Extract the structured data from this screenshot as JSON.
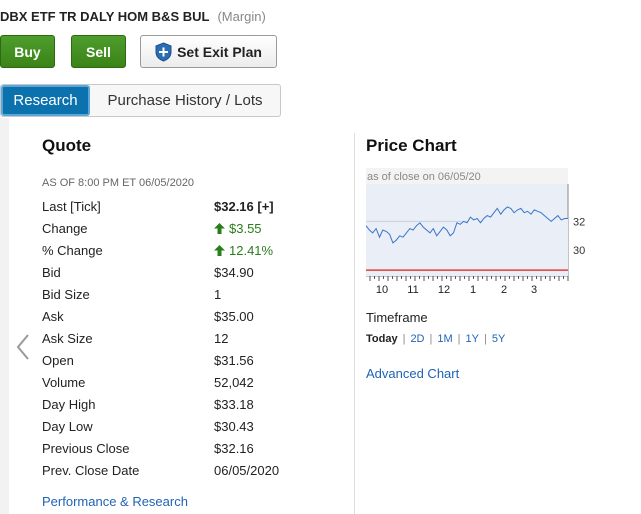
{
  "header": {
    "title": "DBX ETF TR DALY HOM B&S BUL",
    "margin": "(Margin)"
  },
  "actions": {
    "buy": "Buy",
    "sell": "Sell",
    "exit_plan": "Set Exit Plan"
  },
  "tabs": {
    "active": "Research",
    "other": "Purchase History / Lots"
  },
  "quote": {
    "title": "Quote",
    "as_of": "AS OF 8:00 PM ET 06/05/2020",
    "rows": [
      {
        "label": "Last [Tick]",
        "value": "$32.16 [+]"
      },
      {
        "label": "Change",
        "value": "$3.55"
      },
      {
        "label": "% Change",
        "value": "12.41%"
      },
      {
        "label": "Bid",
        "value": "$34.90"
      },
      {
        "label": "Bid Size",
        "value": "1"
      },
      {
        "label": "Ask",
        "value": "$35.00"
      },
      {
        "label": "Ask Size",
        "value": "12"
      },
      {
        "label": "Open",
        "value": "$31.56"
      },
      {
        "label": "Volume",
        "value": "52,042"
      },
      {
        "label": "Day High",
        "value": "$33.18"
      },
      {
        "label": "Day Low",
        "value": "$30.43"
      },
      {
        "label": "Previous Close",
        "value": "$32.16"
      },
      {
        "label": "Prev. Close Date",
        "value": "06/05/2020"
      }
    ],
    "link": "Performance & Research"
  },
  "price_chart": {
    "title": "Price Chart",
    "caption": "as of close on 06/05/20",
    "timeframe_label": "Timeframe",
    "timeframe_options": [
      "Today",
      "2D",
      "1M",
      "1Y",
      "5Y"
    ],
    "selected_timeframe": "Today",
    "advanced_link": "Advanced Chart",
    "colors": {
      "price_line": "#3b75c9",
      "prev_close_line": "#e0413a",
      "area_fill": "#e9eef7"
    }
  },
  "chart_data": {
    "type": "area",
    "title": "",
    "xlabel": "",
    "ylabel": "",
    "x_ticks": [
      "10",
      "11",
      "12",
      "1",
      "2",
      "3"
    ],
    "y_ticks": [
      30,
      32
    ],
    "ylim": [
      28.2,
      34.6
    ],
    "prev_close_reference": 28.61,
    "series": [
      {
        "values": [
          31.7,
          31.4,
          31.2,
          31.5,
          30.9,
          31.4,
          31.3,
          31.1,
          30.5,
          30.7,
          31.0,
          30.9,
          31.2,
          31.5,
          31.4,
          31.7,
          31.9,
          31.6,
          31.4,
          31.2,
          31.5,
          31.0,
          31.3,
          31.6,
          31.4,
          31.0,
          31.2,
          31.9,
          31.8,
          32.0,
          31.9,
          32.3,
          32.1,
          32.2,
          31.9,
          32.2,
          32.4,
          32.3,
          32.6,
          32.9,
          32.5,
          32.8,
          33.0,
          32.9,
          32.6,
          32.8,
          32.9,
          32.6,
          32.7,
          32.5,
          32.8,
          32.7,
          32.6,
          32.4,
          32.2,
          32.0,
          32.2,
          32.4,
          32.1,
          32.2,
          32.2
        ]
      }
    ]
  }
}
